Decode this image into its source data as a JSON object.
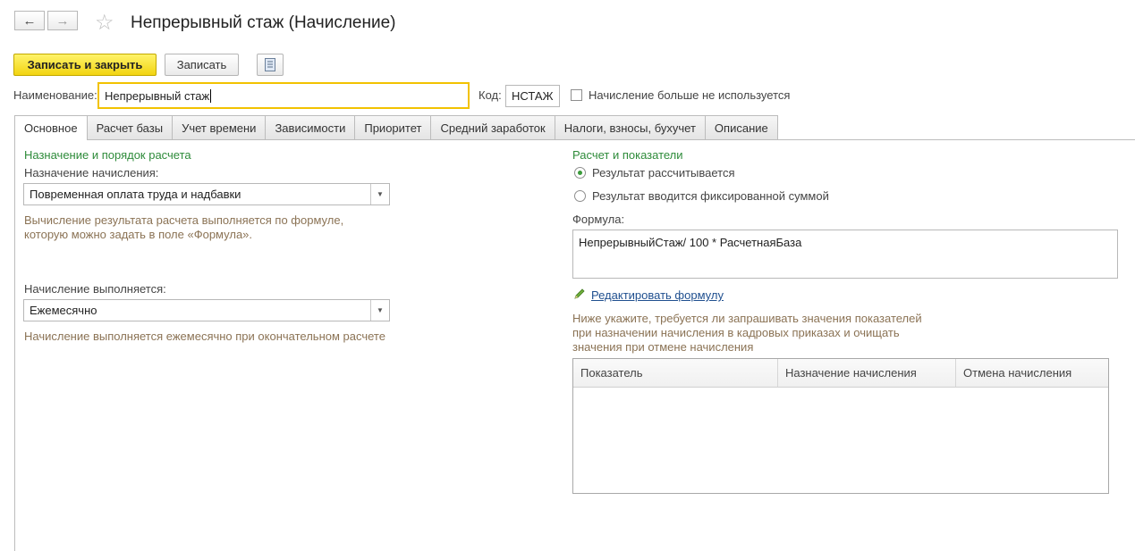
{
  "window": {
    "title": "Непрерывный стаж (Начисление)"
  },
  "nav": {
    "back_icon": "arrow-left-icon",
    "forward_icon": "arrow-right-icon",
    "favorite_icon": "star-icon"
  },
  "toolbar": {
    "save_close_label": "Записать и закрыть",
    "save_label": "Записать",
    "report_icon": "document-list-icon"
  },
  "header": {
    "name_label": "Наименование:",
    "name_value": "Непрерывный стаж",
    "code_label": "Код:",
    "code_value": "НСТАЖ",
    "unused_label": "Начисление больше не используется",
    "unused_checked": false
  },
  "tabs": [
    {
      "label": "Основное",
      "active": true
    },
    {
      "label": "Расчет базы",
      "active": false
    },
    {
      "label": "Учет времени",
      "active": false
    },
    {
      "label": "Зависимости",
      "active": false
    },
    {
      "label": "Приоритет",
      "active": false
    },
    {
      "label": "Средний заработок",
      "active": false
    },
    {
      "label": "Налоги, взносы, бухучет",
      "active": false
    },
    {
      "label": "Описание",
      "active": false
    }
  ],
  "left": {
    "section_title": "Назначение и порядок расчета",
    "purpose_label": "Назначение начисления:",
    "purpose_value": "Повременная оплата труда и надбавки",
    "purpose_hint_line1": "Вычисление результата расчета выполняется по формуле,",
    "purpose_hint_line2": "которую можно задать в поле «Формула».",
    "period_label": "Начисление выполняется:",
    "period_value": "Ежемесячно",
    "period_hint": "Начисление выполняется ежемесячно при окончательном расчете"
  },
  "right": {
    "section_title": "Расчет и показатели",
    "radio_calculated": "Результат рассчитывается",
    "radio_fixed": "Результат вводится фиксированной суммой",
    "selected_radio": "calculated",
    "formula_label": "Формула:",
    "formula_value": "НепрерывныйСтаж/ 100 * РасчетнаяБаза",
    "edit_formula_link": "Редактировать формулу",
    "edit_icon": "pencil-icon",
    "indicators_hint_line1": "Ниже укажите, требуется ли запрашивать значения показателей",
    "indicators_hint_line2": "при назначении начисления в кадровых приказах и очищать",
    "indicators_hint_line3": "значения при отмене начисления",
    "table_headers": [
      "Показатель",
      "Назначение начисления",
      "Отмена начисления"
    ],
    "table_rows": []
  },
  "colors": {
    "primary_button": "#f2d411",
    "focus_border": "#f2c200",
    "section_title": "#2e8b3a",
    "hint_text": "#8b7355",
    "link": "#1f4f8f"
  }
}
